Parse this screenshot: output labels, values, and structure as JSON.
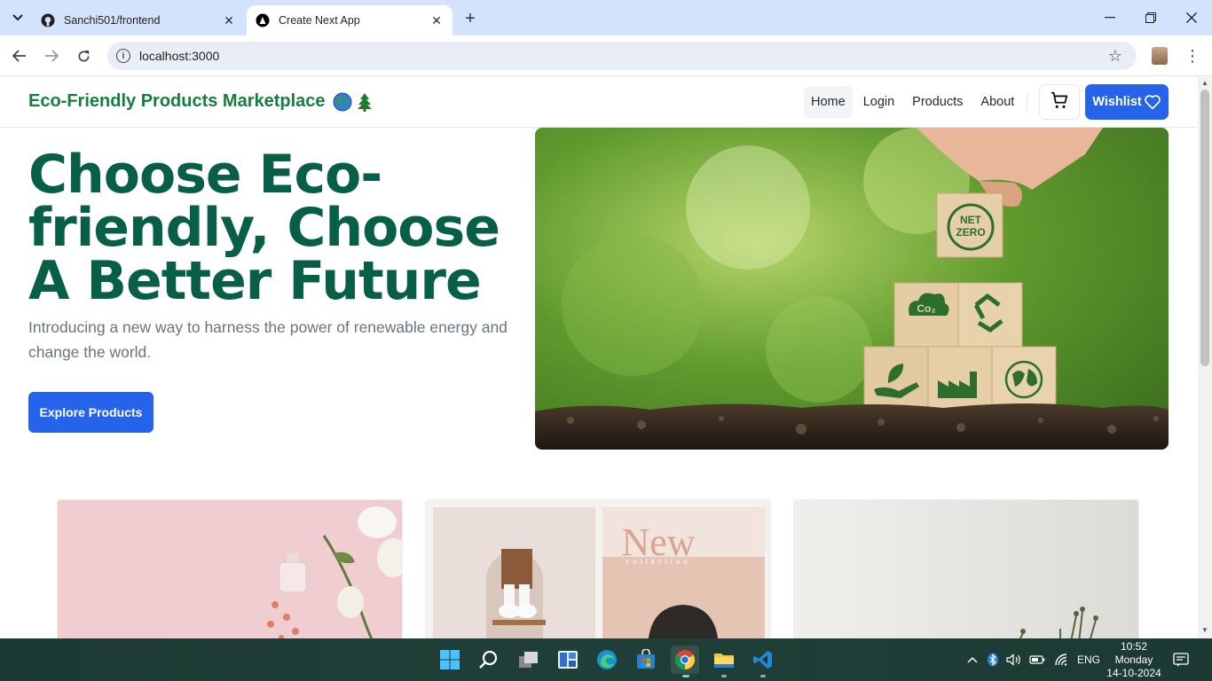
{
  "browser": {
    "tabs": [
      {
        "title": "Sanchi501/frontend",
        "favicon": "github-icon",
        "active": false
      },
      {
        "title": "Create Next App",
        "favicon": "nextjs-icon",
        "active": true
      }
    ],
    "url": "localhost:3000"
  },
  "site": {
    "brand": "Eco-Friendly Products Marketplace",
    "nav": {
      "home": "Home",
      "login": "Login",
      "products": "Products",
      "about": "About",
      "wishlist": "Wishlist"
    },
    "hero": {
      "title": "Choose Eco-friendly, Choose A Better Future",
      "subtitle": "Introducing a new way to harness the power of renewable energy and change the world.",
      "cta": "Explore Products",
      "image_blocks": {
        "top": "NET ZERO",
        "co2": "Co₂"
      }
    },
    "cards": {
      "collection_text": "New",
      "collection_sub": "collection"
    }
  },
  "taskbar": {
    "language": "ENG",
    "time": "10:52",
    "day": "Monday",
    "date": "14-10-2024"
  },
  "colors": {
    "brand_green": "#15803d",
    "hero_title": "#065f46",
    "primary_blue": "#2563eb"
  }
}
